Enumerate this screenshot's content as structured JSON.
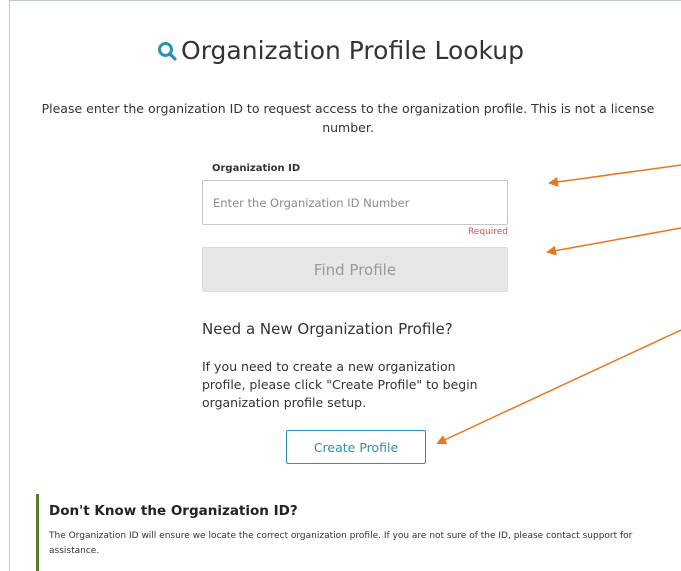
{
  "page": {
    "title": "Organization Profile Lookup",
    "intro": "Please enter the organization ID to request access to the organization profile. This is not a license number."
  },
  "lookup": {
    "field_label": "Organization ID",
    "input_placeholder": "Enter the Organization ID Number",
    "input_value": "",
    "required_text": "Required",
    "find_button_label": "Find Profile",
    "find_button_state": "disabled"
  },
  "new_profile": {
    "heading": "Need a New Organization Profile?",
    "text": "If you need to create a new organization profile, please click \"Create Profile\" to begin organization profile setup.",
    "create_button_label": "Create Profile"
  },
  "info": {
    "heading": "Don't Know the Organization ID?",
    "text": "The Organization ID will ensure we locate the correct organization profile. If you are not sure of the ID, please contact support for assistance."
  },
  "icons": {
    "title_icon": "search-icon"
  },
  "colors": {
    "accent_blue": "#2e8fb5",
    "required_red": "#d9534f",
    "info_border_green": "#5a7a2e",
    "annotation_arrow_orange": "#e8771f",
    "disabled_button_bg": "#e6e6e6"
  }
}
